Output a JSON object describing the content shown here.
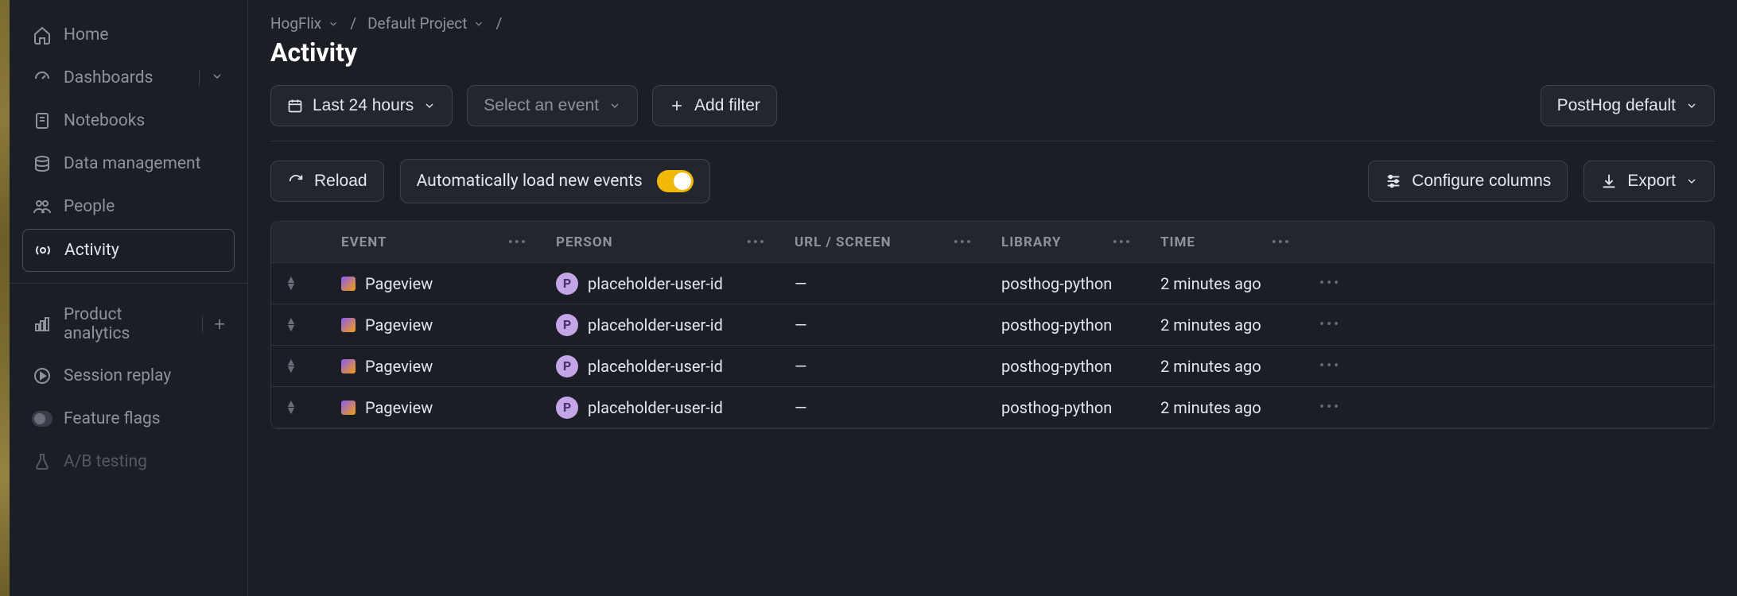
{
  "sidebar": {
    "items": [
      {
        "label": "Home"
      },
      {
        "label": "Dashboards"
      },
      {
        "label": "Notebooks"
      },
      {
        "label": "Data management"
      },
      {
        "label": "People"
      },
      {
        "label": "Activity"
      },
      {
        "label": "Product analytics"
      },
      {
        "label": "Session replay"
      },
      {
        "label": "Feature flags"
      },
      {
        "label": "A/B testing"
      }
    ]
  },
  "breadcrumb": {
    "org": "HogFlix",
    "project": "Default Project",
    "sep": "/"
  },
  "page": {
    "title": "Activity"
  },
  "toolbar": {
    "date_label": "Last 24 hours",
    "event_placeholder": "Select an event",
    "add_filter": "Add filter",
    "config_label": "PostHog default",
    "reload": "Reload",
    "auto_load": "Automatically load new events",
    "configure_columns": "Configure columns",
    "export": "Export"
  },
  "table": {
    "columns": [
      "EVENT",
      "PERSON",
      "URL / SCREEN",
      "LIBRARY",
      "TIME"
    ],
    "rows": [
      {
        "event": "Pageview",
        "person_initial": "P",
        "person": "placeholder-user-id",
        "url": "—",
        "library": "posthog-python",
        "time": "2 minutes ago"
      },
      {
        "event": "Pageview",
        "person_initial": "P",
        "person": "placeholder-user-id",
        "url": "—",
        "library": "posthog-python",
        "time": "2 minutes ago"
      },
      {
        "event": "Pageview",
        "person_initial": "P",
        "person": "placeholder-user-id",
        "url": "—",
        "library": "posthog-python",
        "time": "2 minutes ago"
      },
      {
        "event": "Pageview",
        "person_initial": "P",
        "person": "placeholder-user-id",
        "url": "—",
        "library": "posthog-python",
        "time": "2 minutes ago"
      }
    ]
  }
}
